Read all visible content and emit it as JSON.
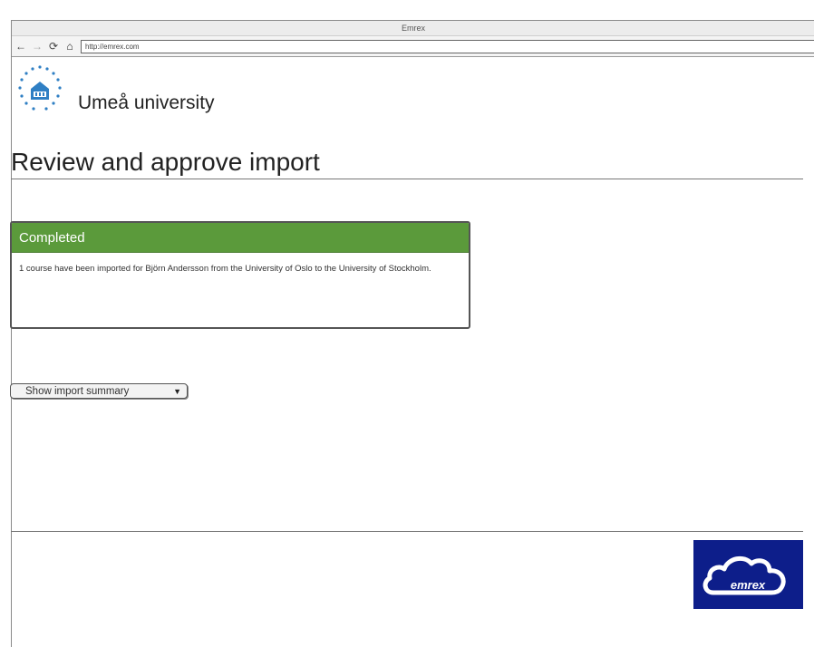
{
  "window": {
    "title": "Emrex"
  },
  "toolbar": {
    "back_icon": "arrow-left-icon",
    "forward_icon": "arrow-right-icon",
    "reload_icon": "reload-icon",
    "home_icon": "home-icon",
    "url": "http://emrex.com"
  },
  "header": {
    "university_name": "Umeå university"
  },
  "page": {
    "title": "Review and approve import"
  },
  "status_panel": {
    "header": "Completed",
    "message": "1 course have been imported for Björn Andersson from the University of Oslo to the University of Stockholm.",
    "header_color": "#5b9a3b"
  },
  "summary_dropdown": {
    "label": "Show import summary"
  },
  "footer": {
    "logo_text": "emrex",
    "logo_bg_color": "#0d1e8a"
  }
}
